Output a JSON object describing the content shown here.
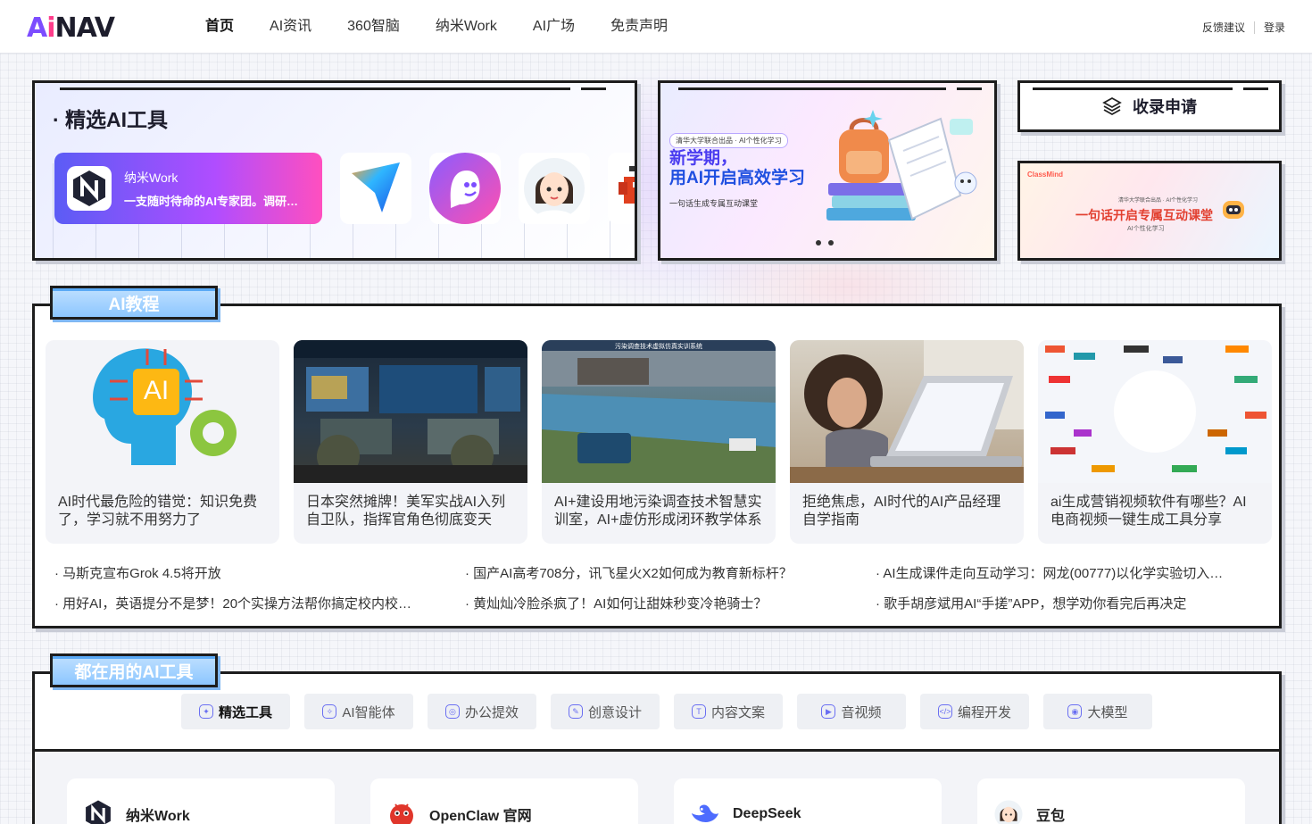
{
  "nav": {
    "logo": {
      "a": "A",
      "i": "i",
      "nav": "NAV"
    },
    "links": [
      "首页",
      "AI资讯",
      "360智脑",
      "纳米Work",
      "AI广场",
      "免责声明"
    ],
    "active_index": 0,
    "feedback": "反馈建议",
    "login": "登录"
  },
  "featured": {
    "title": "· 精选AI工具",
    "main_tool": {
      "name": "纳米Work",
      "desc": "一支随时待命的AI专家团。调研…"
    },
    "icons": [
      "arrow-app-icon",
      "ghost-app-icon",
      "avatar-app-icon",
      "lobster-app-icon"
    ]
  },
  "banner": {
    "badge": "清华大学联合出品 · AI个性化学习",
    "title_line1": "新学期，",
    "title_line2": "用AI开启高效学习",
    "subtitle": "一句话生成专属互动课堂"
  },
  "submit": {
    "label": "收录申请"
  },
  "course": {
    "logo": "ClassMind",
    "small": "清华大学联合出品 · AI个性化学习",
    "title": "一句话开启专属互动课堂",
    "sub": "AI个性化学习"
  },
  "tutorials": {
    "tag": "AI教程",
    "articles": [
      {
        "title": "AI时代最危险的错觉：知识免费了，学习就不用努力了"
      },
      {
        "title": "日本突然摊牌！美军实战AI入列自卫队，指挥官角色彻底变天"
      },
      {
        "title": "AI+建设用地污染调查技术智慧实训室，AI+虚仿形成闭环教学体系"
      },
      {
        "title": "拒绝焦虑，AI时代的AI产品经理自学指南"
      },
      {
        "title": "ai生成营销视频软件有哪些？AI电商视频一键生成工具分享"
      }
    ],
    "thumb3_caption": "污染调查技术虚拟仿真实训系统",
    "news": [
      "马斯克宣布Grok 4.5将开放",
      "国产AI高考708分，讯飞星火X2如何成为教育新标杆？",
      "AI生成课件走向互动学习：网龙(00777)以化学实验切入…",
      "用好AI，英语提分不是梦！20个实操方法帮你搞定校内校…",
      "黄灿灿冷脸杀疯了！AI如何让甜妹秒变冷艳骑士？",
      "歌手胡彦斌用AI“手搓”APP，想学劝你看完后再决定"
    ]
  },
  "common": {
    "tag": "都在用的AI工具",
    "tabs": [
      "精选工具",
      "AI智能体",
      "办公提效",
      "创意设计",
      "内容文案",
      "音视频",
      "编程开发",
      "大模型"
    ],
    "active_tab": 0,
    "tools": [
      "纳米Work",
      "OpenClaw 官网",
      "DeepSeek",
      "豆包"
    ]
  },
  "colors": {
    "accent": "#7c4dff",
    "tag_blue": "#8cc6ff",
    "frame": "#1d1d1d"
  }
}
